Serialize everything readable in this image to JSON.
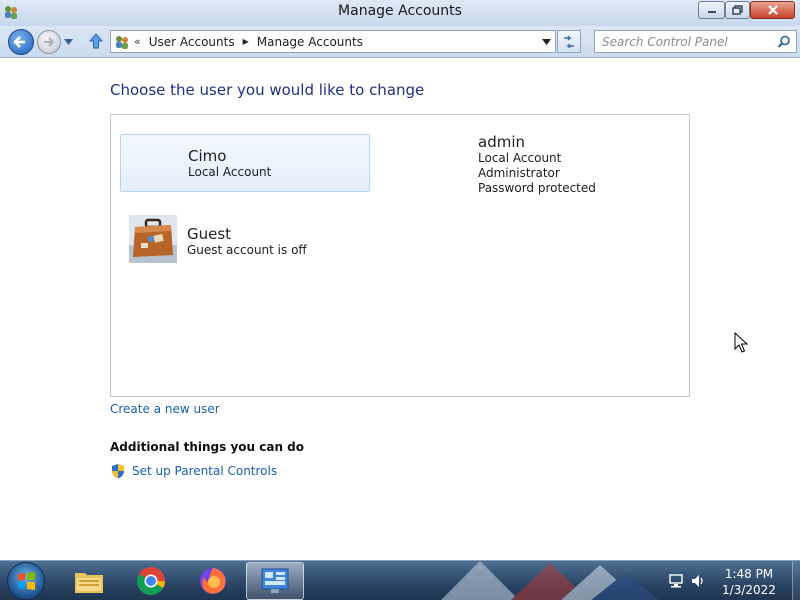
{
  "window": {
    "title": "Manage Accounts",
    "icon": "user-accounts-icon"
  },
  "navigation": {
    "breadcrumb_overflow": "«",
    "breadcrumb": [
      "User Accounts",
      "Manage Accounts"
    ],
    "search_placeholder": "Search Control Panel"
  },
  "main": {
    "heading": "Choose the user you would like to change",
    "accounts": [
      {
        "name": "Cimo",
        "details": [
          "Local Account"
        ],
        "selected": true
      },
      {
        "name": "admin",
        "details": [
          "Local Account",
          "Administrator",
          "Password protected"
        ]
      },
      {
        "name": "Guest",
        "details": [
          "Guest account is off"
        ],
        "picture": "suitcase-picture"
      }
    ],
    "create_link": "Create a new user",
    "additional_heading": "Additional things you can do",
    "additional_links": [
      {
        "label": "Set up Parental Controls",
        "icon": "shield-icon"
      }
    ]
  },
  "taskbar": {
    "pinned": [
      "start-orb",
      "file-explorer-icon",
      "chrome-icon",
      "firefox-icon",
      "control-panel-icon"
    ],
    "active": "control-panel-icon",
    "clock": {
      "time": "1:48 PM",
      "date": "1/3/2022"
    }
  },
  "colors": {
    "heading": "#1e3287",
    "link": "#1a5fb4",
    "selection_border": "#b8d6f0",
    "taskbar": "#2a4463"
  }
}
